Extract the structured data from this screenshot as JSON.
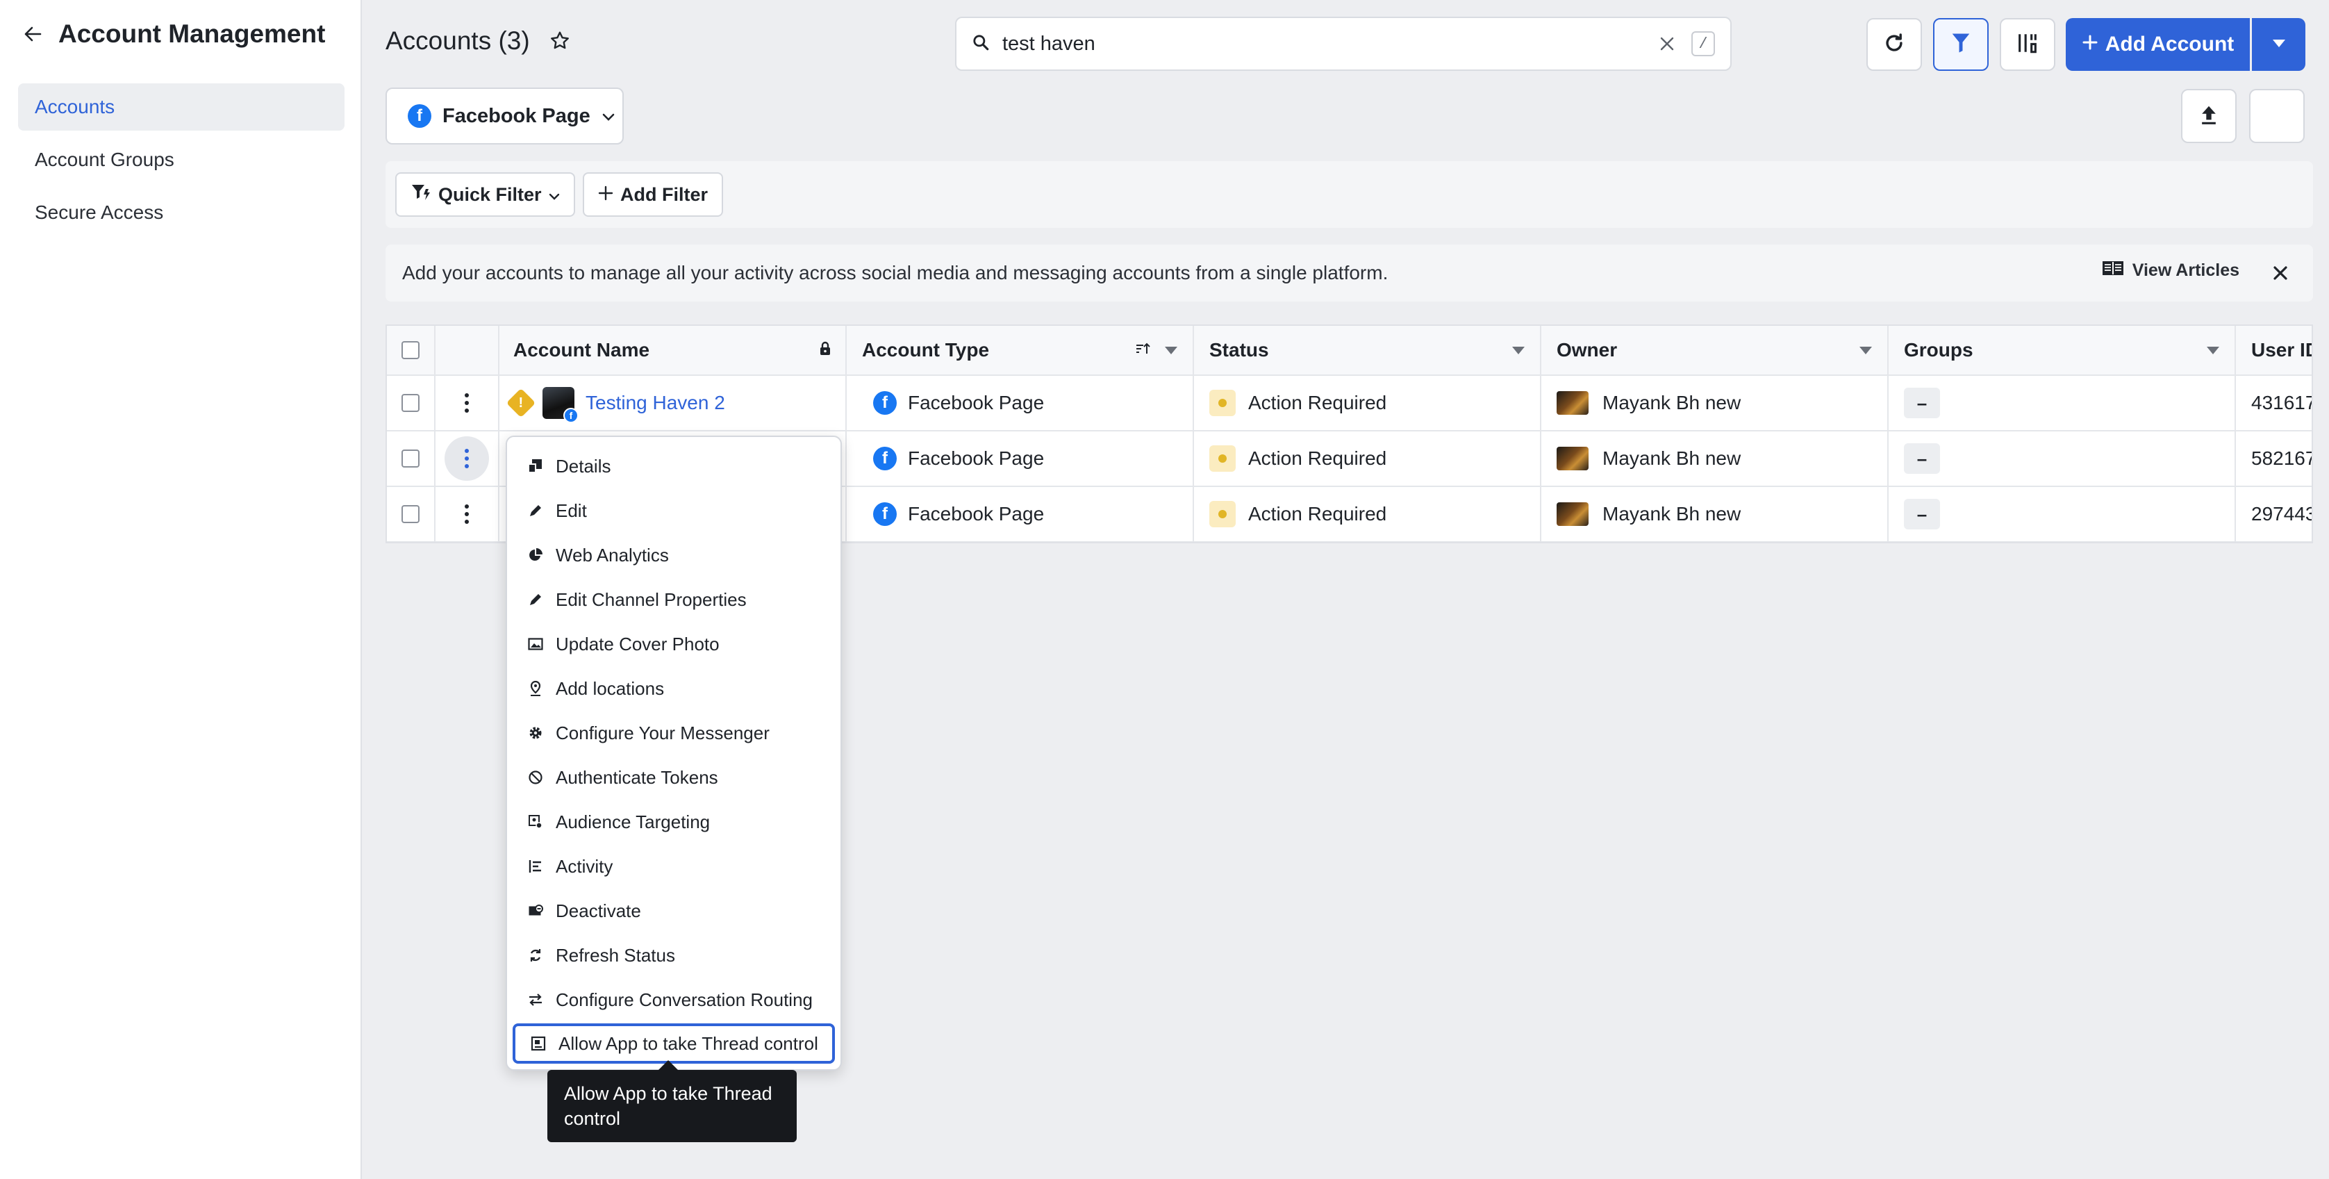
{
  "sidebar": {
    "title": "Account Management",
    "items": [
      {
        "label": "Accounts",
        "active": true
      },
      {
        "label": "Account Groups",
        "active": false
      },
      {
        "label": "Secure Access",
        "active": false
      }
    ]
  },
  "header": {
    "title": "Accounts (3)",
    "search_value": "test haven",
    "search_shortcut": "/",
    "add_account_label": "Add Account"
  },
  "channel_selector": {
    "label": "Facebook Page"
  },
  "filters": {
    "quick_filter": "Quick Filter",
    "add_filter": "Add Filter"
  },
  "banner": {
    "text": "Add your accounts to manage all your activity across social media and messaging accounts from a single platform.",
    "link": "View Articles"
  },
  "table": {
    "columns": [
      "Account Name",
      "Account Type",
      "Status",
      "Owner",
      "Groups",
      "User ID"
    ],
    "rows": [
      {
        "name": "Testing Haven 2",
        "type": "Facebook Page",
        "status": "Action Required",
        "owner": "Mayank Bh new",
        "groups": "–",
        "user_id": "431617"
      },
      {
        "name": "",
        "type": "Facebook Page",
        "status": "Action Required",
        "owner": "Mayank Bh new",
        "groups": "–",
        "user_id": "582167"
      },
      {
        "name": "",
        "type": "Facebook Page",
        "status": "Action Required",
        "owner": "Mayank Bh new",
        "groups": "–",
        "user_id": "297443"
      }
    ]
  },
  "context_menu": {
    "items": [
      {
        "label": "Details",
        "icon": "details-icon"
      },
      {
        "label": "Edit",
        "icon": "pencil-icon"
      },
      {
        "label": "Web Analytics",
        "icon": "pie-chart-icon"
      },
      {
        "label": "Edit Channel Properties",
        "icon": "pencil-icon"
      },
      {
        "label": "Update Cover Photo",
        "icon": "image-icon"
      },
      {
        "label": "Add locations",
        "icon": "location-pin-icon"
      },
      {
        "label": "Configure Your Messenger",
        "icon": "gear-icon"
      },
      {
        "label": "Authenticate Tokens",
        "icon": "token-icon"
      },
      {
        "label": "Audience Targeting",
        "icon": "target-icon"
      },
      {
        "label": "Activity",
        "icon": "activity-icon"
      },
      {
        "label": "Deactivate",
        "icon": "deactivate-icon"
      },
      {
        "label": "Refresh Status",
        "icon": "refresh-icon"
      },
      {
        "label": "Configure Conversation Routing",
        "icon": "swap-arrows-icon"
      },
      {
        "label": "Allow App to take Thread control",
        "icon": "thread-control-icon"
      }
    ]
  },
  "tooltip": {
    "text": "Allow App to take Thread control"
  },
  "colors": {
    "accent": "#2f63d8",
    "facebook": "#1877f2",
    "warning": "#e1b526"
  }
}
